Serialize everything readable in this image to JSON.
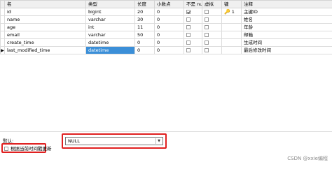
{
  "columns": [
    "名",
    "类型",
    "长度",
    "小数点",
    "不是 null",
    "虚拟",
    "键",
    "注释"
  ],
  "rows": [
    {
      "name": "id",
      "type": "bigint",
      "length": "20",
      "decimals": "0",
      "not_null": true,
      "virtual": false,
      "key": "1",
      "comment": "主键ID",
      "current": false
    },
    {
      "name": "name",
      "type": "varchar",
      "length": "30",
      "decimals": "0",
      "not_null": false,
      "virtual": false,
      "key": "",
      "comment": "姓名",
      "current": false
    },
    {
      "name": "age",
      "type": "int",
      "length": "11",
      "decimals": "0",
      "not_null": false,
      "virtual": false,
      "key": "",
      "comment": "年龄",
      "current": false
    },
    {
      "name": "email",
      "type": "varchar",
      "length": "50",
      "decimals": "0",
      "not_null": false,
      "virtual": false,
      "key": "",
      "comment": "邮箱",
      "current": false
    },
    {
      "name": "create_time",
      "type": "datetime",
      "length": "0",
      "decimals": "0",
      "not_null": false,
      "virtual": false,
      "key": "",
      "comment": "生成时间",
      "current": false
    },
    {
      "name": "last_modified_time",
      "type": "datetime",
      "length": "0",
      "decimals": "0",
      "not_null": false,
      "virtual": false,
      "key": "",
      "comment": "最后修改时间",
      "current": true
    }
  ],
  "current_row_indicator": "▶",
  "key_icon": "key-icon",
  "bottom": {
    "default_label": "默认:",
    "default_value": "NULL",
    "update_checkbox_label": "根据当前时间戳更新",
    "update_checked": false
  },
  "watermark": "CSDN @xxie编程",
  "colors": {
    "selected_cell": "#3b8fd8",
    "highlight_box": "#e02020",
    "key_icon": "#d4a017"
  }
}
